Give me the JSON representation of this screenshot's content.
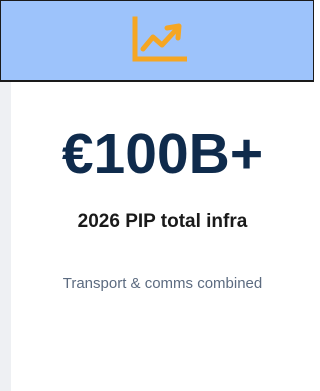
{
  "card": {
    "icon": "trending-up-chart-icon",
    "accent_color": "#f5a623",
    "header_color": "#9dc3fb",
    "value_color": "#0f2b4c",
    "value": "€100B+",
    "label": "2026 PIP total infra",
    "caption": "Transport & comms combined"
  }
}
